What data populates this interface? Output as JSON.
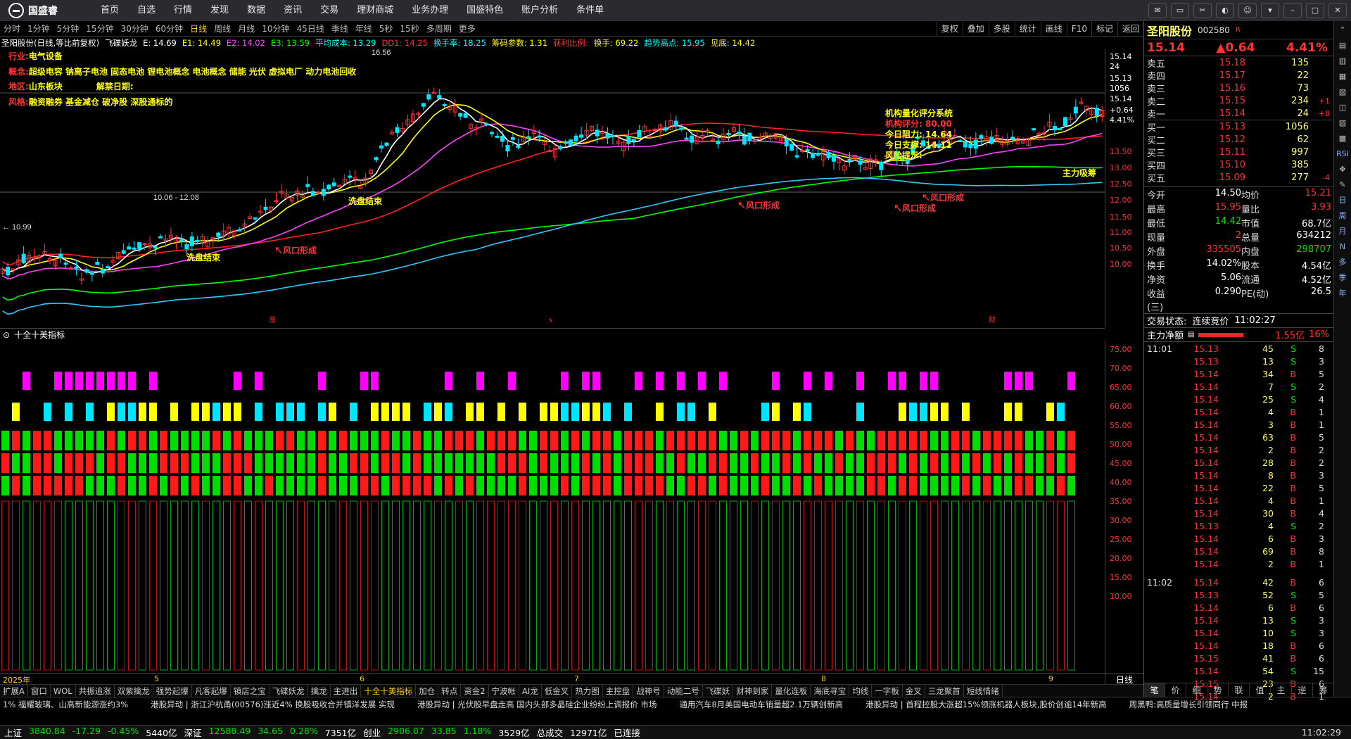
{
  "app": {
    "logo": "国盛睿",
    "menu": [
      "首页",
      "自选",
      "行情",
      "发现",
      "数据",
      "资讯",
      "交易",
      "理财商城",
      "业务办理",
      "国盛特色",
      "账户分析",
      "条件单"
    ],
    "window_controls": [
      {
        "name": "message-icon",
        "glyph": "✉"
      },
      {
        "name": "display-icon",
        "glyph": "▭"
      },
      {
        "name": "tools-icon",
        "glyph": "✂"
      },
      {
        "name": "skin-icon",
        "glyph": "◐"
      },
      {
        "name": "user-icon",
        "glyph": "☺"
      },
      {
        "name": "dropdown-icon",
        "glyph": "▾"
      },
      {
        "name": "minimize-icon",
        "glyph": "–"
      },
      {
        "name": "maximize-icon",
        "glyph": "▢"
      },
      {
        "name": "close-icon",
        "glyph": "✕"
      }
    ]
  },
  "periods": [
    "分时",
    "1分钟",
    "5分钟",
    "15分钟",
    "30分钟",
    "60分钟",
    "日线",
    "周线",
    "月线",
    "10分钟",
    "45日线",
    "季线",
    "年线",
    "5秒",
    "15秒",
    "多周期",
    "更多"
  ],
  "active_period": "日线",
  "toolbar": [
    "复权",
    "叠加",
    "多股",
    "统计",
    "画线",
    "F10",
    "标记",
    "返回"
  ],
  "infobar": [
    {
      "t": "圣阳股份(日线,等比前复权)",
      "c": "ib-white"
    },
    {
      "t": "飞碟妖龙",
      "c": "ib-white"
    },
    {
      "t": "E: 14.69",
      "c": "ib-white"
    },
    {
      "t": "E1: 14.49",
      "c": "ib-yellow"
    },
    {
      "t": "E2: 14.02",
      "c": "ib-magenta"
    },
    {
      "t": "E3: 13.59",
      "c": "ib-green"
    },
    {
      "t": "平均成本: 13.29",
      "c": "ib-cyan"
    },
    {
      "t": "DD1: 14.25",
      "c": "ib-red"
    },
    {
      "t": "换手率: 18.25",
      "c": "ib-cyan"
    },
    {
      "t": "筹码参数: 1.31",
      "c": "ib-yellow"
    },
    {
      "t": "获利比例:",
      "c": "ib-red"
    },
    {
      "t": "换手: 69.22",
      "c": "ib-yellow"
    },
    {
      "t": "趋势高点: 15.95",
      "c": "ib-cyan"
    },
    {
      "t": "见底: 14.42",
      "c": "ib-yellow"
    }
  ],
  "chart_overlay": {
    "industry_label": "行业:",
    "industry": "电气设备",
    "concept_label": "概念:",
    "concepts": "超级电容 钠离子电池 固态电池 锂电池概念 电池概念 储能 光伏 虚拟电厂 动力电池回收",
    "region_label": "地区:",
    "region": "山东板块",
    "unlock_label": "解禁日期:",
    "style_label": "风格:",
    "style": "融资融券 基金减仓 破净股 深股通标的",
    "max_price_label": "16.56",
    "min_price_label": "← 10.99",
    "range_label": "10.06 - 12.08",
    "annotations": [
      "洗盘结束",
      "↖风口形成",
      "洗盘结束",
      "↖风口形成",
      "↖风口形成",
      "↖风口形成",
      "主力吸筹"
    ],
    "rating_box": {
      "title": "机构量化评分系统",
      "score": "机构评分: 80.00",
      "resistance": "今日阻力: 14.64",
      "support": "今日支撑: 14.11",
      "risk": "风险提示:"
    },
    "markers": [
      "涨",
      "s",
      "财"
    ]
  },
  "price_axis": {
    "ticks": [
      "15.14",
      "24",
      "15.13",
      "1056",
      "15.14",
      "+0.64",
      "4.41%",
      "13.50",
      "13.00",
      "12.50",
      "12.00",
      "11.50",
      "11.00",
      "10.50",
      "10.00"
    ]
  },
  "indicator": {
    "title": "十全十美指标",
    "axis": [
      "75.00",
      "70.00",
      "65.00",
      "60.00",
      "55.00",
      "50.00",
      "45.00",
      "40.00",
      "35.00",
      "30.00",
      "25.00",
      "20.00",
      "15.00",
      "10.00"
    ]
  },
  "dates": [
    {
      "t": "2025年",
      "p": 0.002
    },
    {
      "t": "5",
      "p": 0.114
    },
    {
      "t": "6",
      "p": 0.266
    },
    {
      "t": "7",
      "p": 0.425
    },
    {
      "t": "8",
      "p": 0.608
    },
    {
      "t": "9",
      "p": 0.776
    }
  ],
  "bottom_tabs": [
    "扩展A",
    "窗口",
    "WOL",
    "共振追涨",
    "双紫擒龙",
    "强势起爆",
    "凡客起爆",
    "镇店之宝",
    "飞碟妖龙",
    "擒龙",
    "主进出",
    "十全十美指标",
    "加仓",
    "转点",
    "资金2",
    "宁波帐",
    "AI龙",
    "低金叉",
    "热力图",
    "主控盘",
    "战神号",
    "动能二号",
    "飞碟妖",
    "财神到家",
    "量化连板",
    "海底寻宝",
    "均线",
    "一字板",
    "金叉",
    "三龙聚首",
    "短线情绪"
  ],
  "active_bottom_tab": "十全十美指标",
  "news": [
    "1% 福耀玻璃、山高新能源涨约3%",
    "港股异动 | 浙江沪杭甬(00576)涨近4% 换股吸收合并镇洋发展 实现 ",
    "港股异动 | 光伏股早盘走高 国内头部多晶硅企业纷纷上调报价 市场",
    "通用汽车8月美国电动车销量超2.1万辆创新高",
    "港股异动 | 首程控股大涨超15%领涨机器人板块,股价创逾14年新高",
    "周黑鸭:高质量增长引领同行 中报"
  ],
  "status": [
    {
      "t": "上证",
      "c": "st-white"
    },
    {
      "t": "3840.84",
      "c": "st-green"
    },
    {
      "t": "-17.29",
      "c": "st-green"
    },
    {
      "t": "-0.45%",
      "c": "st-green"
    },
    {
      "t": "5440亿",
      "c": "st-white"
    },
    {
      "t": "深证",
      "c": "st-white"
    },
    {
      "t": "12588.49",
      "c": "st-green"
    },
    {
      "t": "34.65",
      "c": "st-green"
    },
    {
      "t": "0.28%",
      "c": "st-green"
    },
    {
      "t": "7351亿",
      "c": "st-white"
    },
    {
      "t": "创业",
      "c": "st-white"
    },
    {
      "t": "2906.07",
      "c": "st-green"
    },
    {
      "t": "33.85",
      "c": "st-green"
    },
    {
      "t": "1.18%",
      "c": "st-green"
    },
    {
      "t": "3529亿",
      "c": "st-white"
    },
    {
      "t": "总成交",
      "c": "st-white"
    },
    {
      "t": "12971亿",
      "c": "st-white"
    },
    {
      "t": "已连接",
      "c": "st-white"
    }
  ],
  "clock": "11:02:29",
  "stock": {
    "name": "圣阳股份",
    "code": "002580",
    "price": "15.14",
    "change": "▲0.64",
    "pct": "4.41%"
  },
  "order_book": {
    "asks": [
      {
        "label": "卖五",
        "price": "15.18",
        "vol": "135",
        "chg": ""
      },
      {
        "label": "卖四",
        "price": "15.17",
        "vol": "22",
        "chg": ""
      },
      {
        "label": "卖三",
        "price": "15.16",
        "vol": "73",
        "chg": ""
      },
      {
        "label": "卖二",
        "price": "15.15",
        "vol": "234",
        "chg": "+1"
      },
      {
        "label": "卖一",
        "price": "15.14",
        "vol": "24",
        "chg": "+8"
      }
    ],
    "bids": [
      {
        "label": "买一",
        "price": "15.13",
        "vol": "1056",
        "chg": ""
      },
      {
        "label": "买二",
        "price": "15.12",
        "vol": "62",
        "chg": ""
      },
      {
        "label": "买三",
        "price": "15.11",
        "vol": "997",
        "chg": ""
      },
      {
        "label": "买四",
        "price": "15.10",
        "vol": "385",
        "chg": ""
      },
      {
        "label": "买五",
        "price": "15.09",
        "vol": "277",
        "chg": "-4"
      }
    ]
  },
  "stats": [
    [
      {
        "l": "今开",
        "v": "14.50",
        "c": "w"
      },
      {
        "l": "均价",
        "v": "15.21",
        "c": ""
      }
    ],
    [
      {
        "l": "最高",
        "v": "15.95",
        "c": ""
      },
      {
        "l": "量比",
        "v": "3.93",
        "c": ""
      }
    ],
    [
      {
        "l": "最低",
        "v": "14.42",
        "c": "g"
      },
      {
        "l": "市值",
        "v": "68.7亿",
        "c": "w"
      }
    ],
    [
      {
        "l": "现量",
        "v": "2",
        "c": ""
      },
      {
        "l": "总量",
        "v": "634212",
        "c": "w"
      }
    ],
    [
      {
        "l": "外盘",
        "v": "335505",
        "c": ""
      },
      {
        "l": "内盘",
        "v": "298707",
        "c": "g"
      }
    ],
    [
      {
        "l": "换手",
        "v": "14.02%",
        "c": "w"
      },
      {
        "l": "股本",
        "v": "4.54亿",
        "c": "w"
      }
    ],
    [
      {
        "l": "净资",
        "v": "5.06",
        "c": "w"
      },
      {
        "l": "流通",
        "v": "4.52亿",
        "c": "w"
      }
    ],
    [
      {
        "l": "收益(三)",
        "v": "0.290",
        "c": "w"
      },
      {
        "l": "PE(动)",
        "v": "26.5",
        "c": "w"
      }
    ]
  ],
  "trade_status": {
    "label": "交易状态:",
    "value": "连续竞价",
    "time": "11:02:27"
  },
  "main_net": {
    "label": "主力净额",
    "value": "1.55亿",
    "pct": "16%"
  },
  "ticks": [
    {
      "t": "11:01",
      "p": "15.13",
      "v": "45",
      "bs": "S",
      "n": "8"
    },
    {
      "t": "",
      "p": "15.13",
      "v": "13",
      "bs": "S",
      "n": "3"
    },
    {
      "t": "",
      "p": "15.14",
      "v": "34",
      "bs": "B",
      "n": "5"
    },
    {
      "t": "",
      "p": "15.14",
      "v": "7",
      "bs": "S",
      "n": "2"
    },
    {
      "t": "",
      "p": "15.14",
      "v": "25",
      "bs": "S",
      "n": "4"
    },
    {
      "t": "",
      "p": "15.14",
      "v": "4",
      "bs": "B",
      "n": "1"
    },
    {
      "t": "",
      "p": "15.14",
      "v": "3",
      "bs": "B",
      "n": "1"
    },
    {
      "t": "",
      "p": "15.14",
      "v": "63",
      "bs": "B",
      "n": "5"
    },
    {
      "t": "",
      "p": "15.14",
      "v": "2",
      "bs": "B",
      "n": "2"
    },
    {
      "t": "",
      "p": "15.14",
      "v": "28",
      "bs": "B",
      "n": "2"
    },
    {
      "t": "",
      "p": "15.14",
      "v": "8",
      "bs": "B",
      "n": "3"
    },
    {
      "t": "",
      "p": "15.14",
      "v": "22",
      "bs": "B",
      "n": "5"
    },
    {
      "t": "",
      "p": "15.14",
      "v": "4",
      "bs": "B",
      "n": "1"
    },
    {
      "t": "",
      "p": "15.14",
      "v": "30",
      "bs": "B",
      "n": "4"
    },
    {
      "t": "",
      "p": "15.13",
      "v": "4",
      "bs": "S",
      "n": "2"
    },
    {
      "t": "",
      "p": "15.14",
      "v": "6",
      "bs": "B",
      "n": "3"
    },
    {
      "t": "",
      "p": "15.14",
      "v": "69",
      "bs": "B",
      "n": "8"
    },
    {
      "t": "",
      "p": "15.14",
      "v": "2",
      "bs": "B",
      "n": "1"
    },
    {
      "t": "11:02",
      "p": "15.14",
      "v": "42",
      "bs": "B",
      "n": "6"
    },
    {
      "t": "",
      "p": "15.13",
      "v": "52",
      "bs": "S",
      "n": "5"
    },
    {
      "t": "",
      "p": "15.14",
      "v": "6",
      "bs": "B",
      "n": "6"
    },
    {
      "t": "",
      "p": "15.14",
      "v": "13",
      "bs": "S",
      "n": "3"
    },
    {
      "t": "",
      "p": "15.14",
      "v": "10",
      "bs": "S",
      "n": "3"
    },
    {
      "t": "",
      "p": "15.14",
      "v": "18",
      "bs": "B",
      "n": "6"
    },
    {
      "t": "",
      "p": "15.15",
      "v": "41",
      "bs": "B",
      "n": "6"
    },
    {
      "t": "",
      "p": "15.14",
      "v": "54",
      "bs": "S",
      "n": "15"
    },
    {
      "t": "",
      "p": "15.15",
      "v": "23",
      "bs": "B",
      "n": "6"
    },
    {
      "t": "",
      "p": "15.14",
      "v": "2",
      "bs": "B",
      "n": "1"
    }
  ],
  "rp_tabs": [
    "笔",
    "价",
    "细",
    "势",
    "联",
    "值",
    "主",
    "逆",
    "筹"
  ],
  "sidebar": [
    {
      "g": "⌃",
      "n": "scroll-up-icon"
    },
    {
      "g": "▤",
      "n": "list-icon"
    },
    {
      "g": "▥",
      "n": "grid-icon"
    },
    {
      "g": "▦",
      "n": "table-icon"
    },
    {
      "g": "▧",
      "n": "layout-icon"
    },
    {
      "g": "◫",
      "n": "split-icon"
    },
    {
      "g": "▨",
      "n": "panel-icon"
    },
    {
      "g": "▩",
      "n": "matrix-icon"
    },
    {
      "g": "RSI",
      "n": "rsi-icon",
      "txt": true
    },
    {
      "g": "✥",
      "n": "move-icon"
    },
    {
      "g": "✎",
      "n": "draw-icon"
    },
    {
      "g": "日",
      "n": "day-icon",
      "txt": true
    },
    {
      "g": "周",
      "n": "week-icon",
      "txt": true
    },
    {
      "g": "月",
      "n": "month-icon",
      "txt": true
    },
    {
      "g": "N",
      "n": "n-icon",
      "txt": true
    },
    {
      "g": "多",
      "n": "multi-icon",
      "txt": true
    },
    {
      "g": "季",
      "n": "quarter-icon",
      "txt": true
    },
    {
      "g": "年",
      "n": "year-icon",
      "txt": true
    }
  ]
}
